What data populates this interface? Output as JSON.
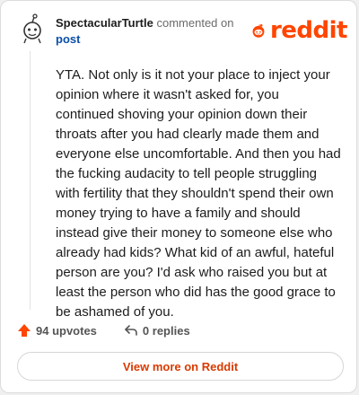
{
  "comment": {
    "username": "SpectacularTurtle",
    "action_text": "commented on",
    "post_link": "post",
    "body": "YTA. Not only is it not your place to inject your opinion where it wasn't asked for, you continued shoving your opinion down their throats after you had clearly made them and everyone else uncomfortable. And then you had the fucking audacity to tell people struggling with fertility that they shouldn't spend their own money trying to have a family and should instead give their money to someone else who already had kids? What kid of an awful, hateful person are you? I'd ask who raised you but at least the person who did has the good grace to be ashamed of you."
  },
  "brand": {
    "logo_text": "reddit",
    "accent_color": "#ff4500",
    "link_color": "#0a4fa8"
  },
  "footer": {
    "upvotes_label": "94 upvotes",
    "replies_label": "0 replies",
    "upvote_icon": "upvote-arrow-icon",
    "reply_icon": "reply-arrow-icon"
  },
  "cta": {
    "label": "View more on Reddit"
  }
}
